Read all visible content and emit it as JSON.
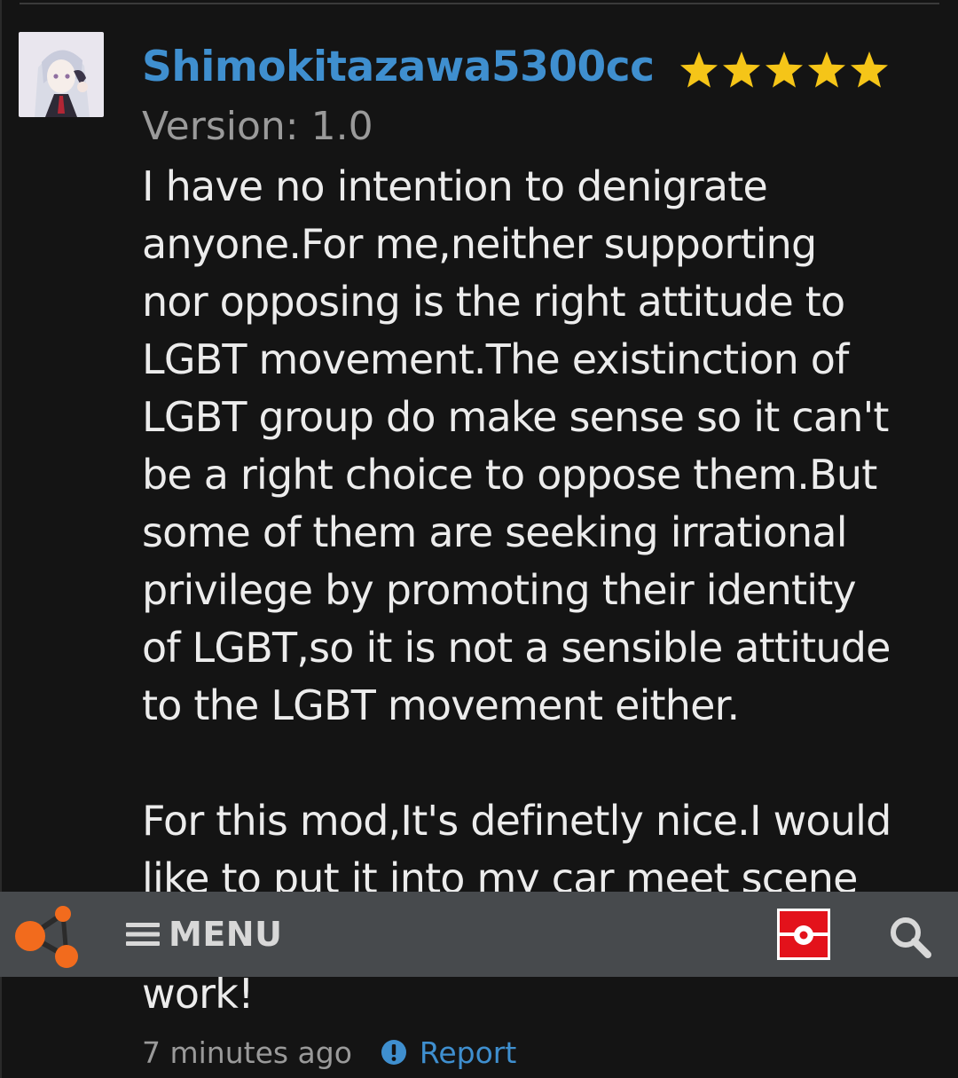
{
  "review": {
    "username": "Shimokitazawa5300cc",
    "rating": 5,
    "rating_max": 5,
    "version": "Version: 1.0",
    "body_lines": [
      "I have no intention to denigrate",
      "anyone.For me,neither supporting",
      "nor opposing is the right attitude to",
      "LGBT movement.The existinction of",
      "LGBT group do make sense so it can't",
      "be a right choice to oppose them.But",
      "some of them are seeking irrational",
      "privilege by promoting their identity",
      "of LGBT,so it is not a sensible attitude",
      "to the LGBT movement either.",
      "",
      "For this mod,It's definetly nice.I would",
      "like to put it into my car meet scene"
    ],
    "body_tail": "work!",
    "timestamp": "7 minutes ago",
    "report_label": "Report"
  },
  "nav": {
    "menu_label": "MENU",
    "logo_icon": "site-logo-icon",
    "notify_icon": "notification-icon",
    "search_icon": "search-icon"
  },
  "colors": {
    "background": "#141414",
    "username": "#3f8fcf",
    "link": "#3f8fcf",
    "star": "#f5c518",
    "nav_bar": "#474a4d",
    "logo_orange": "#f26b1d",
    "notify_red": "#e3121b"
  }
}
